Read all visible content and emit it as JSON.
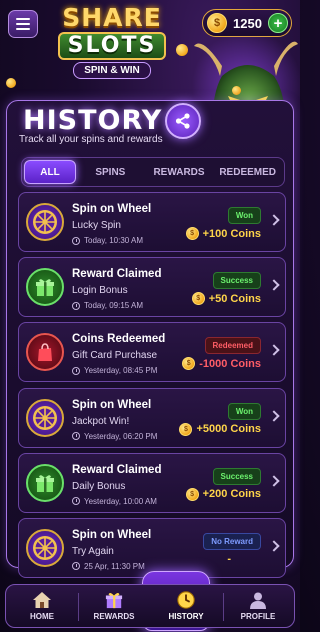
{
  "header": {
    "logo_share": "SHARE",
    "logo_slots": "SLOTS",
    "logo_tagline": "SPIN & WIN",
    "coin_balance": "1250",
    "coin_symbol": "$",
    "plus_label": "+"
  },
  "history": {
    "title": "HISTORY",
    "subtitle": "Track all your spins and rewards"
  },
  "tabs": [
    {
      "label": "ALL",
      "active": true
    },
    {
      "label": "SPINS",
      "active": false
    },
    {
      "label": "REWARDS",
      "active": false
    },
    {
      "label": "REDEEMED",
      "active": false
    }
  ],
  "entries": [
    {
      "icon": "wheel-icon",
      "title": "Spin on Wheel",
      "subtitle": "Lucky Spin",
      "time": "Today, 10:30 AM",
      "badge": "Won",
      "amount": "+100 Coins",
      "status": "won"
    },
    {
      "icon": "gift-icon",
      "title": "Reward Claimed",
      "subtitle": "Login Bonus",
      "time": "Today, 09:15 AM",
      "badge": "Success",
      "amount": "+50 Coins",
      "status": "success"
    },
    {
      "icon": "shopping-bag-icon",
      "title": "Coins Redeemed",
      "subtitle": "Gift Card Purchase",
      "time": "Yesterday, 08:45 PM",
      "badge": "Redeemed",
      "amount": "-1000 Coins",
      "status": "redeemed"
    },
    {
      "icon": "wheel-icon",
      "title": "Spin on Wheel",
      "subtitle": "Jackpot Win!",
      "time": "Yesterday, 06:20 PM",
      "badge": "Won",
      "amount": "+5000 Coins",
      "status": "won"
    },
    {
      "icon": "gift-icon",
      "title": "Reward Claimed",
      "subtitle": "Daily Bonus",
      "time": "Yesterday, 10:00 AM",
      "badge": "Success",
      "amount": "+200 Coins",
      "status": "success"
    },
    {
      "icon": "wheel-icon",
      "title": "Spin on Wheel",
      "subtitle": "Try Again",
      "time": "25 Apr, 11:30 PM",
      "badge": "No Reward",
      "amount": "-",
      "status": "noreward"
    }
  ],
  "nav": [
    {
      "label": "HOME",
      "icon": "home-icon",
      "active": false
    },
    {
      "label": "REWARDS",
      "icon": "gift-icon",
      "active": false
    },
    {
      "label": "HISTORY",
      "icon": "history-clock-icon",
      "active": true
    },
    {
      "label": "PROFILE",
      "icon": "profile-icon",
      "active": false
    }
  ],
  "colors": {
    "accent": "#8a4cff",
    "gold": "#ffd54a",
    "success": "#6cf26e",
    "danger": "#ff5d66",
    "info": "#7e9bff"
  }
}
